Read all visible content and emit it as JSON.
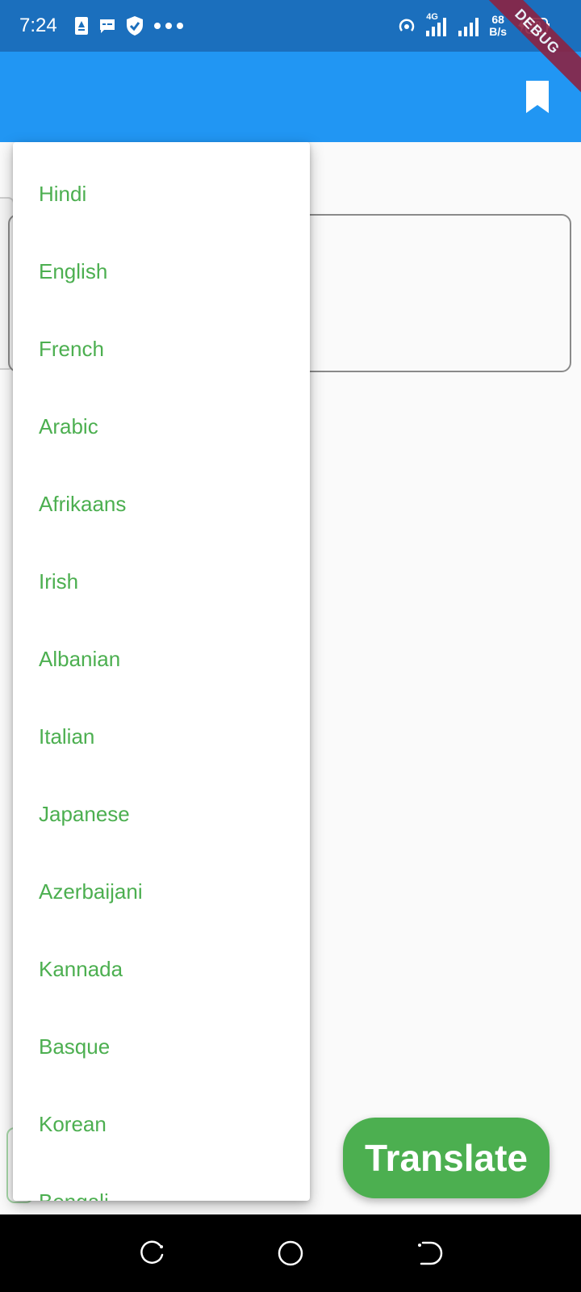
{
  "status_bar": {
    "time": "7:24",
    "network_type": "4G",
    "speed_value": "68",
    "speed_unit": "B/s",
    "battery": "29",
    "left_icons": [
      "drive-upload-icon",
      "message-icon",
      "shield-check-icon",
      "more-dots-icon"
    ],
    "right_icons": [
      "hotspot-icon",
      "signal-4g-icon",
      "signal-icon",
      "battery-icon"
    ]
  },
  "debug_banner": "DEBUG",
  "app_bar": {
    "bookmark_icon": "bookmark-icon",
    "color": "#2196f3"
  },
  "dropdown": {
    "item_color": "#4caf50",
    "items": [
      "Hindi",
      "English",
      "French",
      "Arabic",
      "Afrikaans",
      "Irish",
      "Albanian",
      "Italian",
      "Japanese",
      "Azerbaijani",
      "Kannada",
      "Basque",
      "Korean",
      "Bengali"
    ]
  },
  "translate_button": {
    "label": "Translate",
    "color": "#4caf50"
  },
  "nav_bar": {
    "icons": [
      "recents-icon",
      "home-icon",
      "back-icon"
    ]
  }
}
